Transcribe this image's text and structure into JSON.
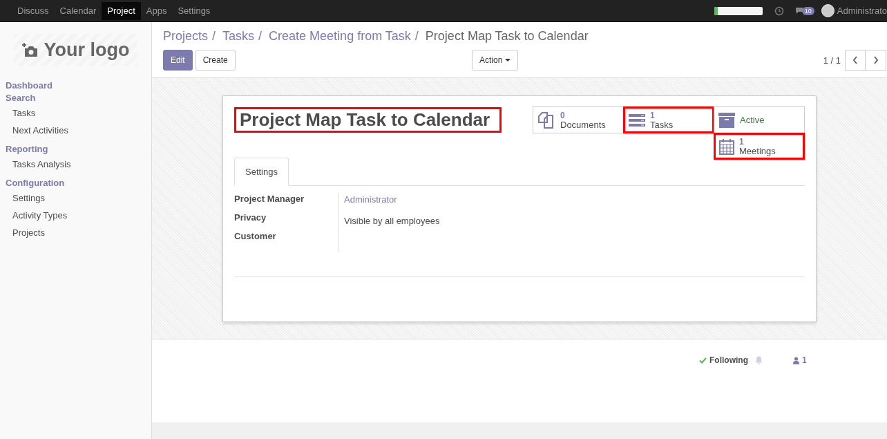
{
  "topbar": {
    "menu": [
      {
        "label": "Discuss",
        "selected": false
      },
      {
        "label": "Calendar",
        "selected": false
      },
      {
        "label": "Project",
        "selected": true
      },
      {
        "label": "Apps",
        "selected": false
      },
      {
        "label": "Settings",
        "selected": false
      }
    ],
    "progress": {
      "level": 0.08
    },
    "message_count": "10",
    "user": "Administrato"
  },
  "sidebar": {
    "logo": "Your logo",
    "sections": [
      {
        "title": "Dashboard"
      },
      {
        "title": "Search",
        "items": [
          "Tasks",
          "Next Activities"
        ]
      },
      {
        "title": "Reporting",
        "items": [
          "Tasks Analysis"
        ]
      },
      {
        "title": "Configuration",
        "items": [
          "Settings",
          "Activity Types",
          "Projects"
        ]
      }
    ]
  },
  "breadcrumbs": [
    {
      "label": "Projects",
      "separator": "/"
    },
    {
      "label": "Tasks",
      "separator": "/"
    },
    {
      "label": "Create Meeting from Task",
      "separator": "/"
    },
    {
      "label": "Project Map Task to Calendar"
    }
  ],
  "buttons": {
    "edit": "Edit",
    "create": "Create",
    "action": "Action"
  },
  "pager": "1 / 1",
  "record": {
    "title": "Project Map Task to Calendar",
    "title_highlighted": true,
    "smart_buttons": [
      {
        "kind": "documents",
        "count": "0",
        "label": "Documents",
        "highlighted": false
      },
      {
        "kind": "tasks",
        "count": "1",
        "label": "Tasks",
        "highlighted": true
      },
      {
        "kind": "active",
        "label": "Active",
        "highlighted": false
      },
      {
        "kind": "meetings",
        "count": "1",
        "label": "Meetings",
        "highlighted": true
      }
    ],
    "tabs": [
      {
        "label": "Settings",
        "selected": true
      }
    ],
    "fields": [
      {
        "label": "Project Manager",
        "value": "Administrator",
        "link": true
      },
      {
        "label": "Privacy",
        "value": "Visible by all employees",
        "link": false
      },
      {
        "label": "Customer"
      }
    ]
  },
  "chatter": {
    "following": "Following",
    "followers": "1"
  }
}
